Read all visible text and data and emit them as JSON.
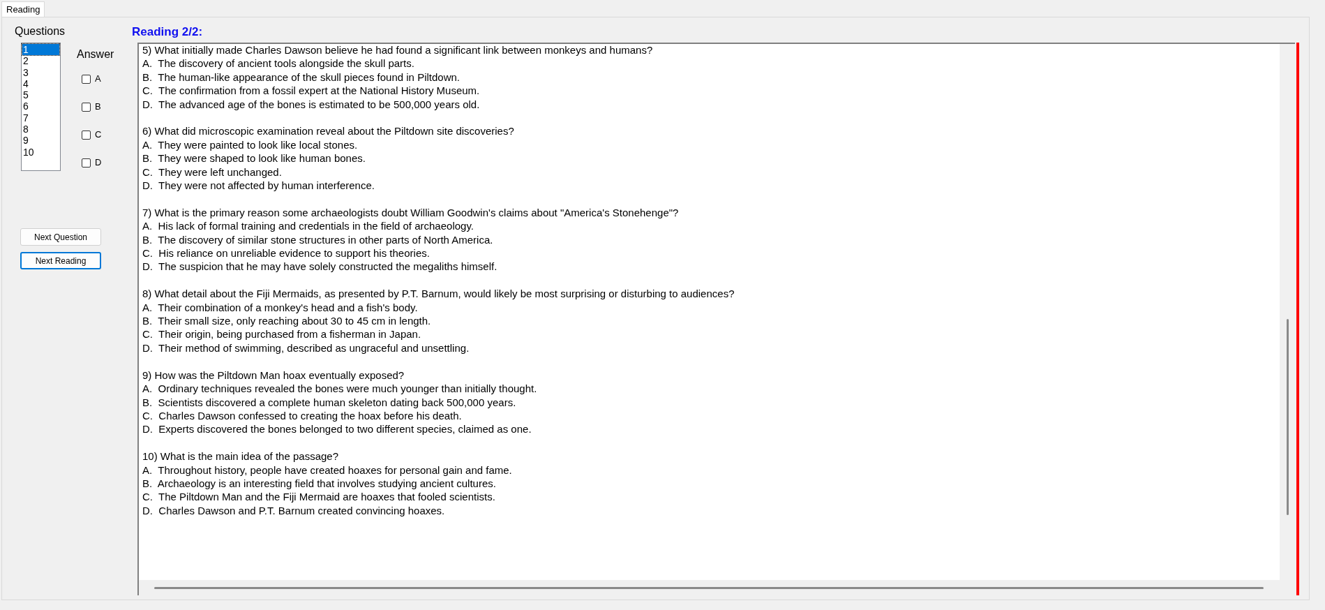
{
  "tabs": [
    {
      "label": "Reading",
      "selected": true
    }
  ],
  "questions_label": "Questions",
  "question_list": [
    {
      "label": "1",
      "selected": true
    },
    {
      "label": "2",
      "selected": false
    },
    {
      "label": "3",
      "selected": false
    },
    {
      "label": "4",
      "selected": false
    },
    {
      "label": "5",
      "selected": false
    },
    {
      "label": "6",
      "selected": false
    },
    {
      "label": "7",
      "selected": false
    },
    {
      "label": "8",
      "selected": false
    },
    {
      "label": "9",
      "selected": false
    },
    {
      "label": "10",
      "selected": false
    }
  ],
  "answer_label": "Answer",
  "answers": [
    {
      "label": "A",
      "checked": false
    },
    {
      "label": "B",
      "checked": false
    },
    {
      "label": "C",
      "checked": false
    },
    {
      "label": "D",
      "checked": false
    }
  ],
  "buttons": [
    {
      "label": "Next Question",
      "focused": false
    },
    {
      "label": "Next Reading",
      "focused": true
    }
  ],
  "reading_title": "Reading 2/2:",
  "passage": [
    {
      "question": "5) What initially made Charles Dawson believe he had found a significant link between monkeys and humans?",
      "options": [
        "A.  The discovery of ancient tools alongside the skull parts.",
        "B.  The human-like appearance of the skull pieces found in Piltdown.",
        "C.  The confirmation from a fossil expert at the National History Museum.",
        "D.  The advanced age of the bones is estimated to be 500,000 years old."
      ]
    },
    {
      "question": "6) What did microscopic examination reveal about the Piltdown site discoveries?",
      "options": [
        "A.  They were painted to look like local stones.",
        "B.  They were shaped to look like human bones.",
        "C.  They were left unchanged.",
        "D.  They were not affected by human interference."
      ]
    },
    {
      "question": "7) What is the primary reason some archaeologists doubt William Goodwin's claims about \"America's Stonehenge\"?",
      "options": [
        "A.  His lack of formal training and credentials in the field of archaeology.",
        "B.  The discovery of similar stone structures in other parts of North America.",
        "C.  His reliance on unreliable evidence to support his theories.",
        "D.  The suspicion that he may have solely constructed the megaliths himself."
      ]
    },
    {
      "question": "8) What detail about the Fiji Mermaids, as presented by P.T. Barnum, would likely be most surprising or disturbing to audiences?",
      "options": [
        "A.  Their combination of a monkey's head and a fish's body.",
        "B.  Their small size, only reaching about 30 to 45 cm in length.",
        "C.  Their origin, being purchased from a fisherman in Japan.",
        "D.  Their method of swimming, described as ungraceful and unsettling."
      ]
    },
    {
      "question": "9) How was the Piltdown Man hoax eventually exposed?",
      "options": [
        "A.  Ordinary techniques revealed the bones were much younger than initially thought.",
        "B.  Scientists discovered a complete human skeleton dating back 500,000 years.",
        "C.  Charles Dawson confessed to creating the hoax before his death.",
        "D.  Experts discovered the bones belonged to two different species, claimed as one."
      ]
    },
    {
      "question": "10) What is the main idea of the passage?",
      "options": [
        "A.  Throughout history, people have created hoaxes for personal gain and fame.",
        "B.  Archaeology is an interesting field that involves studying ancient cultures.",
        "C.  The Piltdown Man and the Fiji Mermaid are hoaxes that fooled scientists.",
        "D.  Charles Dawson and P.T. Barnum created convincing hoaxes."
      ]
    }
  ]
}
